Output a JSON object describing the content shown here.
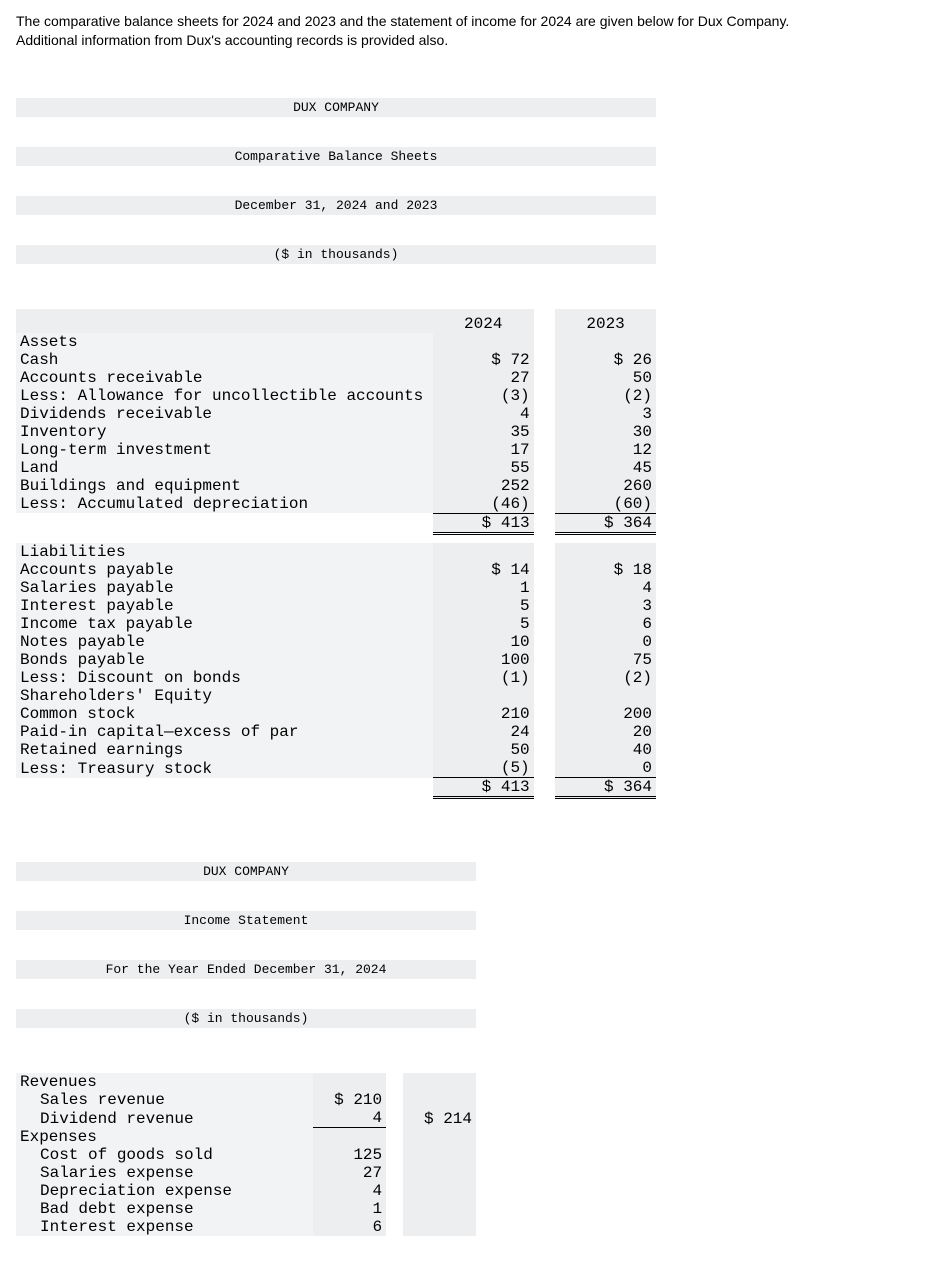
{
  "intro": {
    "line1": "The comparative balance sheets for 2024 and 2023 and the statement of income for 2024 are given below for Dux Company.",
    "line2": "Additional information from Dux's accounting records is provided also."
  },
  "balance": {
    "h1": "DUX COMPANY",
    "h2": "Comparative Balance Sheets",
    "h3": "December 31, 2024 and 2023",
    "h4": "($ in thousands)",
    "col1": "2024",
    "col2": "2023",
    "sec_assets": "Assets",
    "r1": {
      "l": "Cash",
      "a": "$ 72",
      "b": "$ 26"
    },
    "r2": {
      "l": "Accounts receivable",
      "a": "27",
      "b": "50"
    },
    "r3": {
      "l": "  Less: Allowance for uncollectible accounts",
      "a": "(3)",
      "b": "(2)"
    },
    "r4": {
      "l": "Dividends receivable",
      "a": "4",
      "b": "3"
    },
    "r5": {
      "l": "Inventory",
      "a": "35",
      "b": "30"
    },
    "r6": {
      "l": "Long-term investment",
      "a": "17",
      "b": "12"
    },
    "r7": {
      "l": "Land",
      "a": "55",
      "b": "45"
    },
    "r8": {
      "l": "Buildings and equipment",
      "a": "252",
      "b": "260"
    },
    "r9": {
      "l": "  Less: Accumulated depreciation",
      "a": "(46)",
      "b": "(60)"
    },
    "total_assets": {
      "a": "$ 413",
      "b": "$ 364"
    },
    "sec_liab": "Liabilities",
    "l1": {
      "l": "Accounts payable",
      "a": "$ 14",
      "b": "$ 18"
    },
    "l2": {
      "l": "Salaries payable",
      "a": "1",
      "b": "4"
    },
    "l3": {
      "l": "Interest payable",
      "a": "5",
      "b": "3"
    },
    "l4": {
      "l": "Income tax payable",
      "a": "5",
      "b": "6"
    },
    "l5": {
      "l": "Notes payable",
      "a": "10",
      "b": "0"
    },
    "l6": {
      "l": "Bonds payable",
      "a": "100",
      "b": "75"
    },
    "l7": {
      "l": "  Less: Discount on bonds",
      "a": "(1)",
      "b": "(2)"
    },
    "sec_eq": "Shareholders' Equity",
    "e1": {
      "l": "Common stock",
      "a": "210",
      "b": "200"
    },
    "e2": {
      "l": "Paid-in capital—excess of par",
      "a": "24",
      "b": "20"
    },
    "e3": {
      "l": "Retained earnings",
      "a": "50",
      "b": "40"
    },
    "e4": {
      "l": "  Less: Treasury stock",
      "a": "(5)",
      "b": "0"
    },
    "total_le": {
      "a": "$ 413",
      "b": "$ 364"
    }
  },
  "income": {
    "h1": "DUX COMPANY",
    "h2": "Income Statement",
    "h3": "For the Year Ended December 31, 2024",
    "h4": "($ in thousands)",
    "sec_rev": "Revenues",
    "rv1": {
      "l": "Sales revenue",
      "a": "$ 210"
    },
    "rv2": {
      "l": "Dividend revenue",
      "a": "4",
      "t": "$ 214"
    },
    "sec_exp": "Expenses",
    "ex1": {
      "l": "Cost of goods sold",
      "a": "125"
    },
    "ex2": {
      "l": "Salaries expense",
      "a": "27"
    },
    "ex3": {
      "l": "Depreciation expense",
      "a": "4"
    },
    "ex4": {
      "l": "Bad debt expense",
      "a": "1"
    },
    "ex5": {
      "l": "Interest expense",
      "a": "6"
    }
  }
}
